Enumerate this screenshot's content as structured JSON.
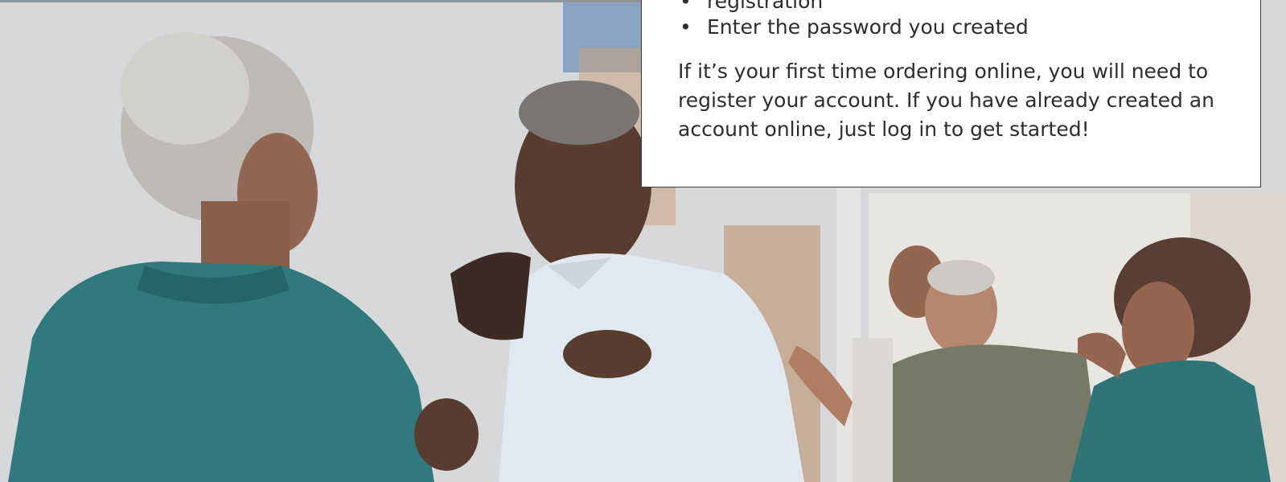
{
  "info_card": {
    "bullets": [
      {
        "text": "registration"
      },
      {
        "text": "Enter the password you created"
      }
    ],
    "paragraph": "If it’s your first time ordering online, you will need to register your account. If you have already created an account online, just log in to get started!"
  },
  "photo": {
    "description_icon": "dancing-seniors-photo",
    "colors": {
      "teal": "#1f6f73",
      "shirt": "#dfe6ee",
      "skin_dark": "#4a2c1e",
      "wall": "#d4d6d8",
      "wood": "#9a6a43"
    }
  }
}
